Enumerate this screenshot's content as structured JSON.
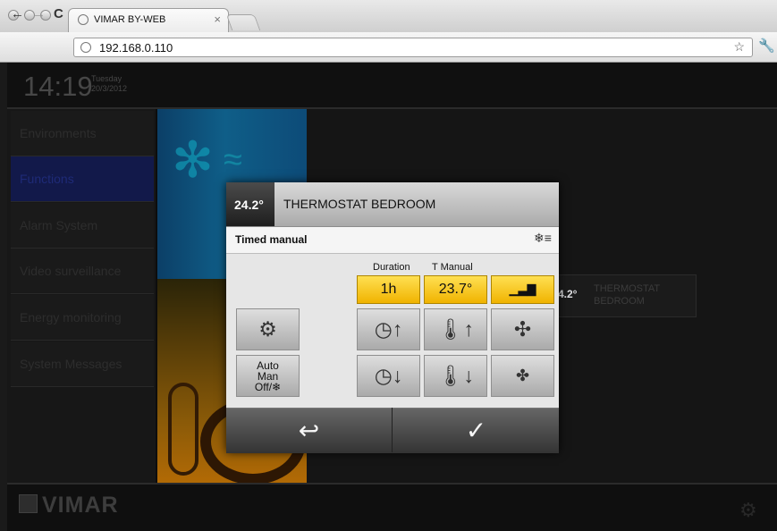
{
  "browser": {
    "tab_title": "VIMAR BY-WEB",
    "close_icon": "×",
    "url": "192.168.0.110",
    "back_icon": "←",
    "forward_icon": "→",
    "reload_icon": "C",
    "star_icon": "☆",
    "wrench_icon": "🔧"
  },
  "app": {
    "time": "14:19",
    "day": "Tuesday",
    "date": "20/3/2012",
    "menu": [
      "Environments",
      "Functions",
      "Alarm System",
      "Video surveillance",
      "Energy monitoring",
      "System Messages"
    ],
    "brand": "VIMAR"
  },
  "widget": {
    "temp": "4.2°",
    "name_line1": "THERMOSTAT",
    "name_line2": "BEDROOM"
  },
  "dialog": {
    "temperature": "24.2°",
    "title": "THERMOSTAT BEDROOM",
    "mode": "Timed manual",
    "duration_label": "Duration",
    "t_manual_label": "T Manual",
    "duration_value": "1h",
    "t_manual_value": "23.7°",
    "auto_line1": "Auto",
    "auto_line2": "Man",
    "auto_line3": "Off/❄"
  },
  "icons": {
    "mode": "❄≡",
    "settings": "⚙",
    "clock_up": "◷↑",
    "temp_up": "🌡↑",
    "fan_large": "✣",
    "clock_down": "◷↓",
    "temp_down": "🌡↓",
    "fan_small": "✤",
    "back": "↩",
    "confirm": "✓",
    "level": "▁▃▇",
    "snowflake": "✻",
    "waves": "≈"
  }
}
